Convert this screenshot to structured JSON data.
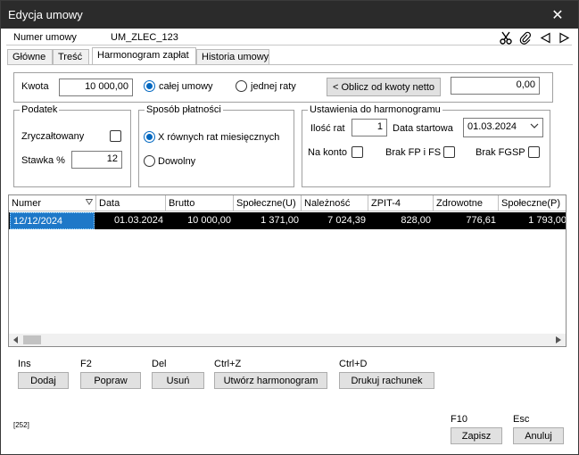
{
  "window": {
    "title": "Edycja umowy"
  },
  "header": {
    "label": "Numer umowy",
    "value": "UM_ZLEC_123"
  },
  "toolbar_icons": [
    "scissors-icon",
    "paperclip-icon",
    "arrow-left-icon",
    "arrow-right-icon"
  ],
  "tabs": [
    {
      "label": "Główne"
    },
    {
      "label": "Treść"
    },
    {
      "label": "Harmonogram zapłat",
      "active": true
    },
    {
      "label": "Historia umowy"
    }
  ],
  "amount": {
    "label": "Kwota",
    "value": "10 000,00",
    "radio_whole": "całej umowy",
    "radio_installment": "jednej raty",
    "calc_button": "< Oblicz od kwoty netto",
    "net_value": "0,00"
  },
  "tax": {
    "title": "Podatek",
    "flat_label": "Zryczałtowany",
    "rate_label": "Stawka %",
    "rate_value": "12"
  },
  "payment": {
    "title": "Sposób płatności",
    "option_equal": "X równych rat miesięcznych",
    "option_any": "Dowolny"
  },
  "schedule": {
    "title": "Ustawienia do harmonogramu",
    "count_label": "Ilość rat",
    "count_value": "1",
    "start_label": "Data startowa",
    "start_value": "01.03.2024",
    "account_label": "Na konto",
    "no_fp_label": "Brak FP i FS",
    "no_fgsp_label": "Brak FGSP"
  },
  "table": {
    "columns": [
      "Numer",
      "Data",
      "Brutto",
      "Społeczne(U)",
      "Należność",
      "ZPIT-4",
      "Zdrowotne",
      "Społeczne(P)"
    ],
    "rows": [
      [
        "12/12/2024",
        "01.03.2024",
        "10 000,00",
        "1 371,00",
        "7 024,39",
        "828,00",
        "776,61",
        "1 793,00"
      ]
    ]
  },
  "actions": {
    "add": {
      "key": "Ins",
      "label": "Dodaj"
    },
    "edit": {
      "key": "F2",
      "label": "Popraw"
    },
    "delete": {
      "key": "Del",
      "label": "Usuń"
    },
    "create": {
      "key": "Ctrl+Z",
      "label": "Utwórz harmonogram"
    },
    "print": {
      "key": "Ctrl+D",
      "label": "Drukuj rachunek"
    }
  },
  "footer": {
    "code": "[252]",
    "save": {
      "key": "F10",
      "label": "Zapisz"
    },
    "cancel": {
      "key": "Esc",
      "label": "Anuluj"
    }
  }
}
